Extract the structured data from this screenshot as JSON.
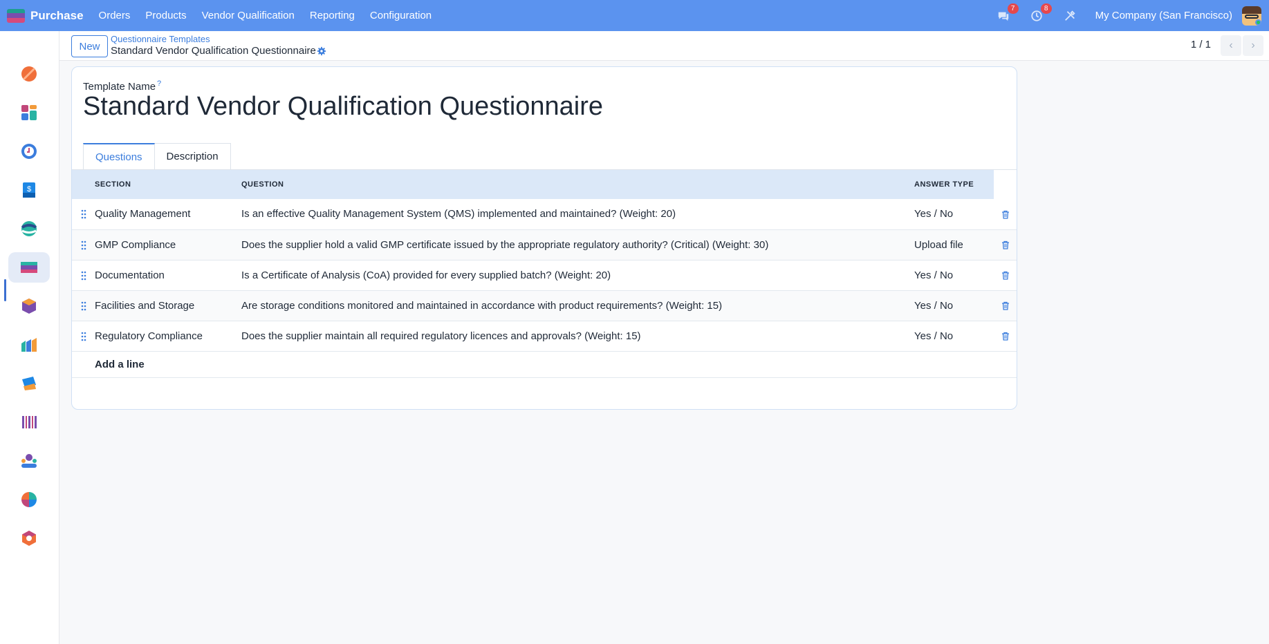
{
  "navbar": {
    "app_name": "Purchase",
    "menu": [
      "Orders",
      "Products",
      "Vendor Qualification",
      "Reporting",
      "Configuration"
    ],
    "messages_count": "7",
    "activities_count": "8",
    "company": "My Company (San Francisco)",
    "icons": [
      "apps-logo-icon",
      "chat-icon",
      "clock-icon",
      "tools-icon",
      "avatar"
    ],
    "color": "#5b93ef"
  },
  "sidebar": {
    "apps": [
      {
        "name": "discuss-app-icon",
        "active": false
      },
      {
        "name": "dashboard-app-icon",
        "active": false
      },
      {
        "name": "clock-app-icon",
        "active": false
      },
      {
        "name": "invoicing-app-icon",
        "active": false
      },
      {
        "name": "crm-app-icon",
        "active": false
      },
      {
        "name": "purchase-app-icon",
        "active": true
      },
      {
        "name": "inventory-app-icon",
        "active": false
      },
      {
        "name": "manufacturing-app-icon",
        "active": false
      },
      {
        "name": "quality-app-icon",
        "active": false
      },
      {
        "name": "barcode-app-icon",
        "active": false
      },
      {
        "name": "employees-app-icon",
        "active": false
      },
      {
        "name": "studio-app-icon",
        "active": false
      },
      {
        "name": "settings-app-icon",
        "active": false
      }
    ]
  },
  "control": {
    "new_label": "New",
    "breadcrumb_parent": "Questionnaire Templates",
    "breadcrumb_current": "Standard Vendor Qualification Questionnaire",
    "pager": "1 / 1"
  },
  "form": {
    "template_name_label": "Template Name",
    "help_mark": "?",
    "template_name": "Standard Vendor Qualification Questionnaire",
    "tabs": [
      "Questions",
      "Description"
    ],
    "active_tab": "Questions",
    "columns": [
      "SECTION",
      "QUESTION",
      "ANSWER TYPE"
    ],
    "lines": [
      {
        "section": "Quality Management",
        "question": "Is an effective Quality Management System (QMS) implemented and maintained? (Weight: 20)",
        "answer_type": "Yes / No"
      },
      {
        "section": "GMP Compliance",
        "question": "Does the supplier hold a valid GMP certificate issued by the appropriate regulatory authority? (Critical) (Weight: 30)",
        "answer_type": "Upload file"
      },
      {
        "section": "Documentation",
        "question": "Is a Certificate of Analysis (CoA) provided for every supplied batch? (Weight: 20)",
        "answer_type": "Yes / No"
      },
      {
        "section": "Facilities and Storage",
        "question": "Are storage conditions monitored and maintained in accordance with product requirements? (Weight: 15)",
        "answer_type": "Yes / No"
      },
      {
        "section": "Regulatory Compliance",
        "question": "Does the supplier maintain all required regulatory licences and approvals? (Weight: 15)",
        "answer_type": "Yes / No"
      }
    ],
    "add_line_label": "Add a line"
  }
}
